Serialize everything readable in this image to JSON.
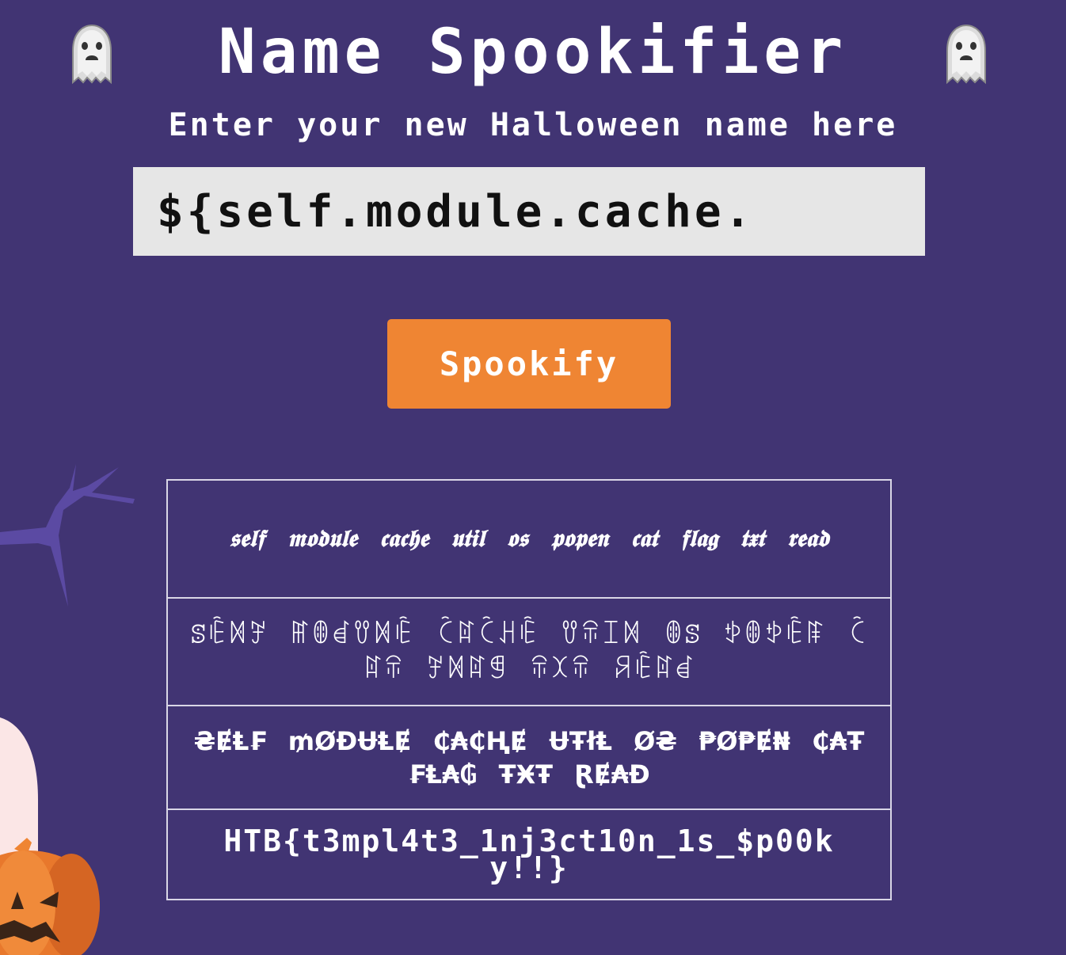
{
  "header": {
    "title": "Name Spookifier",
    "left_icon": "ghost-icon",
    "right_icon": "ghost-icon"
  },
  "subtitle": "Enter your new Halloween name here",
  "name_input": {
    "value": "${self.module.cache."
  },
  "spookify_button": {
    "label": "Spookify"
  },
  "results": {
    "rows": [
      {
        "text": "𝖘𝖊𝖑𝖋 𝖒𝖔𝖉𝖚𝖑𝖊 𝖈𝖆𝖈𝖍𝖊 𝖚𝖙𝖎𝖑 𝖔𝖘 𝖕𝖔𝖕𝖊𝖓 𝖈𝖆𝖙 𝖋𝖑𝖆𝖌 𝖙𝖝𝖙 𝖗𝖊𝖆𝖉"
      },
      {
        "text": "ꕷꍟꁒꎇ ꂵꂦꀸꀎꁒꍟ ꉓꍏꉓꃅꍟ ꀎꋖꀤꁒ ꂦꕷ ꉣꂦꉣꍟꁹ ꉓꍏꋖ ꎇꁒꍏꁅ ꋖꉧꋖ ꋪꍟꍏꀸ"
      },
      {
        "text": "₴ɆⱠ₣ ₥ØĐɄⱠɆ ₵₳₵ⱧɆ ɄŦłⱠ Ø₴ ₱Ø₱Ɇ₦ ₵₳Ŧ ₣Ⱡ₳₲ ŦӾŦ ⱤɆ₳Đ"
      },
      {
        "text": "HTB{t3mpl4t3_1nj3ct10n_1s_$p00ky!!}"
      }
    ]
  },
  "decorations": {
    "tree": "tree-branch-icon",
    "pumpkin": "pumpkin-icon",
    "tombstone": "tombstone-icon"
  },
  "colors": {
    "background": "#413473",
    "button": "#ef8533",
    "input_background": "#e6e6e6",
    "table_border": "#d9d6e6"
  }
}
